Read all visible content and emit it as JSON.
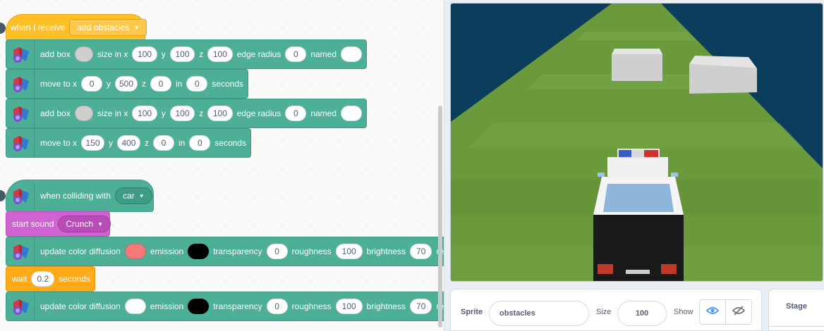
{
  "script1": {
    "hat": {
      "label": "when I receive",
      "message": "add obstacles"
    },
    "add_box_1": {
      "label": "add box",
      "size_label": "size in x",
      "x": "100",
      "y_label": "y",
      "y": "100",
      "z_label": "z",
      "z": "100",
      "edge_label": "edge radius",
      "edge": "0",
      "named_label": "named",
      "name": ""
    },
    "move_1": {
      "label": "move to x",
      "x": "0",
      "y_label": "y",
      "y": "500",
      "z_label": "z",
      "z": "0",
      "in_label": "in",
      "secs": "0",
      "secs_label": "seconds"
    },
    "add_box_2": {
      "label": "add box",
      "size_label": "size in x",
      "x": "100",
      "y_label": "y",
      "y": "100",
      "z_label": "z",
      "z": "100",
      "edge_label": "edge radius",
      "edge": "0",
      "named_label": "named",
      "name": ""
    },
    "move_2": {
      "label": "move to x",
      "x": "150",
      "y_label": "y",
      "y": "400",
      "z_label": "z",
      "z": "0",
      "in_label": "in",
      "secs": "0",
      "secs_label": "seconds"
    }
  },
  "script2": {
    "hat": {
      "label": "when colliding with",
      "target": "car"
    },
    "sound": {
      "label": "start sound",
      "sound": "Crunch"
    },
    "update_1": {
      "label": "update color diffusion",
      "emission_label": "emission",
      "transparency_label": "transparency",
      "transparency": "0",
      "roughness_label": "roughness",
      "roughness": "100",
      "brightness_label": "brightness",
      "brightness": "70",
      "trail": "re",
      "diffusion_color": "#f27a7a",
      "emission_color": "#000000"
    },
    "wait": {
      "label": "wait",
      "secs": "0.2",
      "secs_label": "seconds"
    },
    "update_2": {
      "label": "update color diffusion",
      "emission_label": "emission",
      "transparency_label": "transparency",
      "transparency": "0",
      "roughness_label": "roughness",
      "roughness": "100",
      "brightness_label": "brightness",
      "brightness": "70",
      "trail": "re",
      "diffusion_color": "#ffffff",
      "emission_color": "#000000"
    }
  },
  "sprite_info": {
    "sprite_label": "Sprite",
    "sprite_name": "obstacles",
    "size_label": "Size",
    "size": "100",
    "show_label": "Show"
  },
  "stage_panel": {
    "label": "Stage"
  },
  "colors": {
    "event": "#ffbf26",
    "motion_3d": "#4caf96",
    "sound": "#cf63cf",
    "control": "#ffab19",
    "sky": "#0b3d5c",
    "grass": "#6a9a3c"
  }
}
